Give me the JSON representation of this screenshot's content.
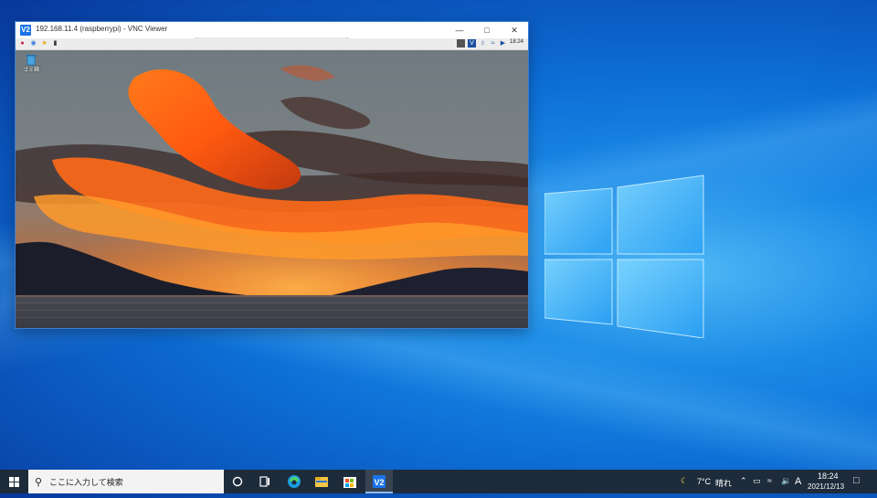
{
  "vnc": {
    "title": "192.168.11.4 (raspberrypi) - VNC Viewer",
    "app_icon": "V2",
    "minimize_icon": "minimize-icon",
    "maximize_icon": "maximize-icon",
    "close_icon": "close-icon",
    "panel": {
      "clock": "18:24",
      "icons": [
        "raspberry-menu-icon",
        "browser-icon",
        "file-manager-icon",
        "terminal-icon"
      ],
      "tray_icons": [
        "cpu-monitor-icon",
        "vnc-icon",
        "bluetooth-icon",
        "wifi-icon",
        "volume-icon"
      ]
    },
    "desktop": {
      "trash_label": "ゴミ箱",
      "wallpaper": "sunset-clouds-over-lake"
    }
  },
  "taskbar": {
    "search_placeholder": "ここに入力して検索",
    "apps": [
      "cortana-icon",
      "task-view-icon",
      "edge-icon",
      "file-explorer-icon",
      "store-icon",
      "vnc-viewer-icon"
    ],
    "weather": {
      "temp": "7°C",
      "condition": "晴れ"
    },
    "ime": "A",
    "time": "18:24",
    "date": "2021/12/13"
  },
  "colors": {
    "taskbar_bg": "#1d2b3a",
    "accent": "#1a73e8"
  }
}
